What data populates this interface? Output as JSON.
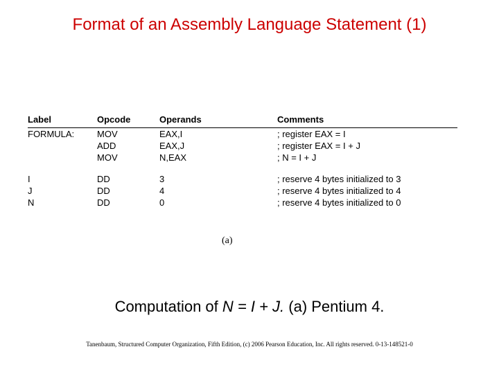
{
  "title": "Format of an Assembly Language Statement (1)",
  "headers": {
    "label": "Label",
    "opcode": "Opcode",
    "operands": "Operands",
    "comments": "Comments"
  },
  "rows_code": [
    {
      "label": "FORMULA:",
      "opcode": "MOV",
      "operands": "EAX,I",
      "comments": ";  register EAX = I"
    },
    {
      "label": "",
      "opcode": "ADD",
      "operands": "EAX,J",
      "comments": ";  register EAX = I + J"
    },
    {
      "label": "",
      "opcode": "MOV",
      "operands": "N,EAX",
      "comments": ";  N = I + J"
    }
  ],
  "rows_data": [
    {
      "label": "I",
      "opcode": "DD",
      "operands": "3",
      "comments": ";  reserve 4 bytes initialized to 3"
    },
    {
      "label": "J",
      "opcode": "DD",
      "operands": "4",
      "comments": ";  reserve 4 bytes initialized to 4"
    },
    {
      "label": "N",
      "opcode": "DD",
      "operands": "0",
      "comments": ";  reserve 4 bytes initialized to 0"
    }
  ],
  "sublabel": "(a)",
  "caption_prefix": "Computation of ",
  "caption_italic": "N = I + J.",
  "caption_suffix": "   (a) Pentium 4.",
  "footer": "Tanenbaum, Structured Computer Organization, Fifth Edition, (c) 2006 Pearson Education, Inc. All rights reserved. 0-13-148521-0"
}
